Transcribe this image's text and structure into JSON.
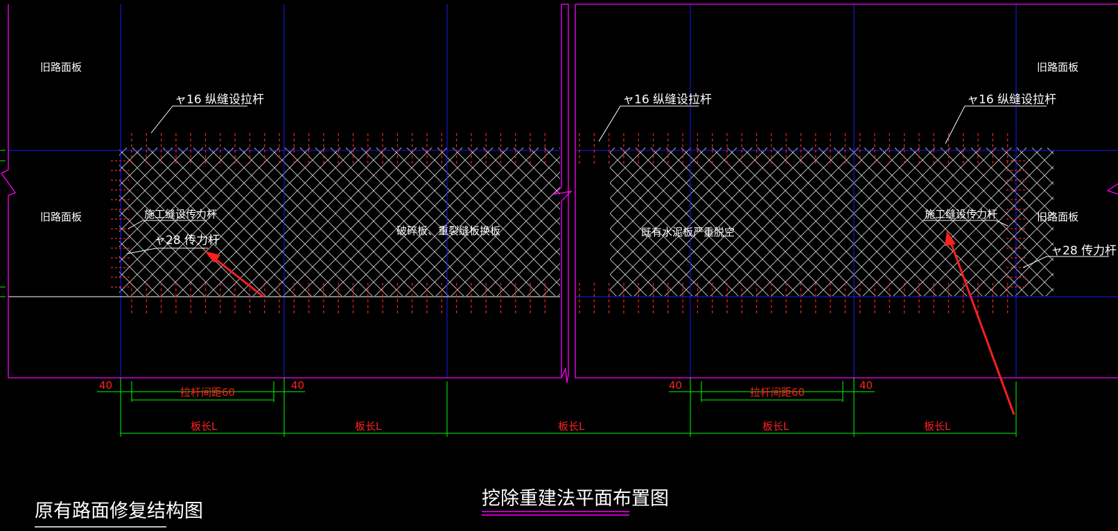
{
  "drawing": {
    "left_title": "原有路面修复结构图",
    "main_title": "挖除重建法平面布置图"
  },
  "labels": {
    "old_slab": "旧路面板",
    "tie_bar": "ャ16 纵缝设拉杆",
    "construction_joint": "施工缝设传力杆",
    "dowel_bar": "ャ28 传力杆",
    "broken_slab_replace": "破碎板、重裂缝板换板",
    "void_slab": "既有水泥板严重脱空"
  },
  "dimensions": {
    "edge_offset": "40",
    "bar_spacing": "拉杆间距60",
    "slab_length": "板长L"
  },
  "colors": {
    "background": "#000000",
    "border": "#ff00ff",
    "grid": "#1a1aff",
    "hatch": "#ffffff",
    "bars": "#ff2020",
    "dimension": "#00ff00",
    "arrow": "#ff2020"
  }
}
